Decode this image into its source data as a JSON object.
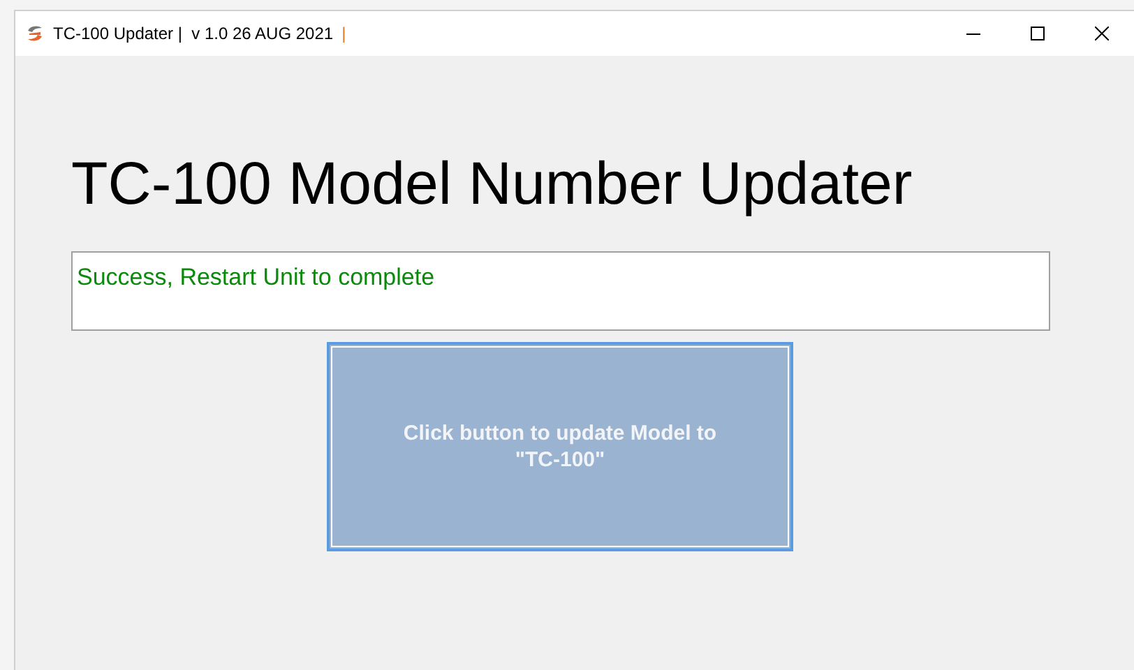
{
  "window": {
    "title": "TC-100 Updater |  v 1.0 26 AUG 2021",
    "title_cursor": "|"
  },
  "heading": "TC-100 Model Number Updater",
  "status_box": {
    "value": "Success, Restart Unit to complete"
  },
  "update_button": {
    "label": "Click button to update Model to \"TC-100\""
  }
}
